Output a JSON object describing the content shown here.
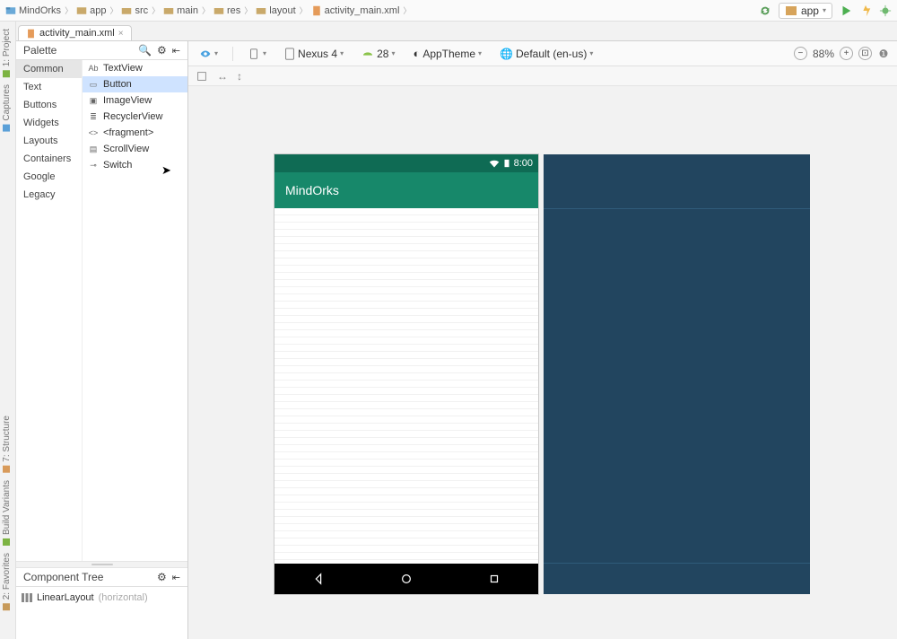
{
  "breadcrumbs": [
    {
      "icon": "project",
      "label": "MindOrks"
    },
    {
      "icon": "module",
      "label": "app"
    },
    {
      "icon": "folder",
      "label": "src"
    },
    {
      "icon": "folder",
      "label": "main"
    },
    {
      "icon": "folder",
      "label": "res"
    },
    {
      "icon": "folder",
      "label": "layout"
    },
    {
      "icon": "xml",
      "label": "activity_main.xml"
    }
  ],
  "run_config": {
    "label": "app"
  },
  "file_tab": {
    "label": "activity_main.xml"
  },
  "dock": {
    "project": "1: Project",
    "captures": "Captures",
    "structure": "7: Structure",
    "variants": "Build Variants",
    "favorites": "2: Favorites"
  },
  "palette": {
    "title": "Palette",
    "categories": [
      "Common",
      "Text",
      "Buttons",
      "Widgets",
      "Layouts",
      "Containers",
      "Google",
      "Legacy"
    ],
    "selected_category": "Common",
    "widgets": [
      {
        "icon": "Ab",
        "label": "TextView"
      },
      {
        "icon": "▭",
        "label": "Button",
        "selected": true
      },
      {
        "icon": "▣",
        "label": "ImageView"
      },
      {
        "icon": "≣",
        "label": "RecyclerView"
      },
      {
        "icon": "<>",
        "label": "<fragment>"
      },
      {
        "icon": "▤",
        "label": "ScrollView"
      },
      {
        "icon": "⊸",
        "label": "Switch"
      }
    ]
  },
  "component_tree": {
    "title": "Component Tree",
    "root": {
      "label": "LinearLayout",
      "hint": "(horizontal)"
    }
  },
  "design_toolbar": {
    "device": "Nexus 4",
    "api": "28",
    "theme": "AppTheme",
    "locale": "Default (en-us)"
  },
  "zoom": {
    "value": "88%"
  },
  "preview": {
    "status_time": "8:00",
    "app_title": "MindOrks"
  }
}
